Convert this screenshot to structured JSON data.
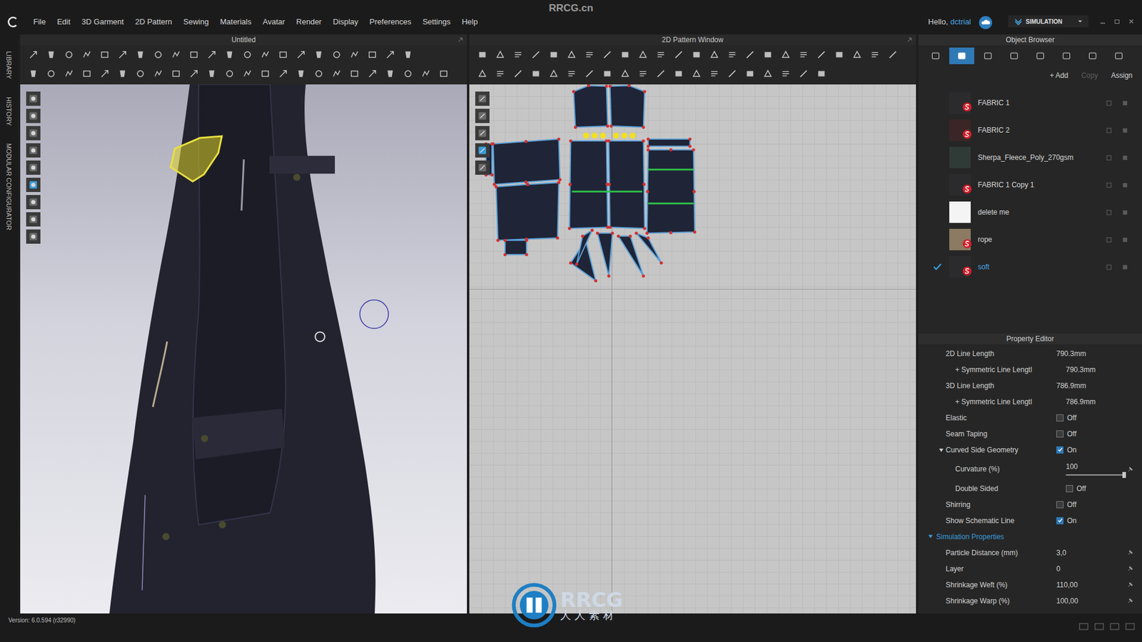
{
  "watermark": {
    "site": "RRCG.cn",
    "logo": "RRCG",
    "logo_sub": "人人素材"
  },
  "menu": [
    "File",
    "Edit",
    "3D Garment",
    "2D Pattern",
    "Sewing",
    "Materials",
    "Avatar",
    "Render",
    "Display",
    "Preferences",
    "Settings",
    "Help"
  ],
  "user": {
    "greeting": "Hello,",
    "name": "dctrial"
  },
  "mode": "SIMULATION",
  "side_tabs": [
    "LIBRARY",
    "HISTORY",
    "MODULAR CONFIGURATOR"
  ],
  "panes": {
    "view3d": "Untitled",
    "view2d": "2D Pattern Window"
  },
  "object_browser": {
    "title": "Object Browser",
    "tabs": [
      {
        "selected": false
      },
      {
        "selected": true
      },
      {
        "selected": false
      },
      {
        "selected": false
      },
      {
        "selected": false
      },
      {
        "selected": false
      },
      {
        "selected": false
      },
      {
        "selected": false
      }
    ],
    "actions": [
      {
        "label": "+ Add",
        "disabled": false
      },
      {
        "label": "Copy",
        "disabled": true
      },
      {
        "label": "Assign",
        "disabled": false
      }
    ],
    "fabrics": [
      {
        "name": "FABRIC 1",
        "color": "#2b2b2d",
        "badge": true,
        "selected": false
      },
      {
        "name": "FABRIC 2",
        "color": "#3a2626",
        "badge": true,
        "selected": false
      },
      {
        "name": "Sherpa_Fleece_Poly_270gsm",
        "color": "#2f3b37",
        "badge": false,
        "selected": false
      },
      {
        "name": "FABRIC 1 Copy 1",
        "color": "#2b2b2d",
        "badge": true,
        "selected": false
      },
      {
        "name": "delete me",
        "color": "#f4f4f4",
        "badge": false,
        "selected": false
      },
      {
        "name": "rope",
        "color": "#8c7a62",
        "badge": true,
        "selected": false
      },
      {
        "name": "soft",
        "color": "#2b2b2d",
        "badge": true,
        "selected": true
      }
    ]
  },
  "property_editor": {
    "title": "Property Editor",
    "rows": [
      {
        "kind": "value",
        "label": "2D Line Length",
        "value": "790.3mm",
        "indent": 0,
        "pin": false
      },
      {
        "kind": "value",
        "label": "+ Symmetric Line Lengtl",
        "value": "790.3mm",
        "indent": 1,
        "pin": false
      },
      {
        "kind": "value",
        "label": "3D Line Length",
        "value": "786.9mm",
        "indent": 0,
        "pin": false
      },
      {
        "kind": "value",
        "label": "+ Symmetric Line Lengtl",
        "value": "786.9mm",
        "indent": 1,
        "pin": false
      },
      {
        "kind": "checkbox",
        "label": "Elastic",
        "value": "Off",
        "checked": false,
        "indent": 0,
        "pin": false
      },
      {
        "kind": "checkbox",
        "label": "Seam Taping",
        "value": "Off",
        "checked": false,
        "indent": 0,
        "pin": false
      },
      {
        "kind": "group",
        "label": "Curved Side Geometry",
        "value": "On",
        "checked": true,
        "expanded": true,
        "indent": 0,
        "pin": false
      },
      {
        "kind": "slider",
        "label": "Curvature (%)",
        "value": "100",
        "level": 1,
        "indent": 1,
        "pin": true
      },
      {
        "kind": "checkbox",
        "label": "Double Sided",
        "value": "Off",
        "checked": false,
        "indent": 1,
        "pin": false
      },
      {
        "kind": "checkbox",
        "label": "Shirring",
        "value": "Off",
        "checked": false,
        "indent": 0,
        "pin": false
      },
      {
        "kind": "checkbox",
        "label": "Show Schematic Line",
        "value": "On",
        "checked": true,
        "indent": 0,
        "pin": false
      },
      {
        "kind": "section",
        "label": "Simulation Properties",
        "expanded": true,
        "indent": 0,
        "pin": false
      },
      {
        "kind": "value",
        "label": "Particle Distance (mm)",
        "value": "3,0",
        "indent": 0,
        "pin": true
      },
      {
        "kind": "value",
        "label": "Layer",
        "value": "0",
        "indent": 0,
        "pin": true
      },
      {
        "kind": "value",
        "label": "Shrinkage Weft (%)",
        "value": "110,00",
        "indent": 0,
        "pin": true
      },
      {
        "kind": "value",
        "label": "Shrinkage Warp (%)",
        "value": "100,00",
        "indent": 0,
        "pin": true
      }
    ]
  },
  "status_bar": "Version: 6.0.594 (r32990)"
}
